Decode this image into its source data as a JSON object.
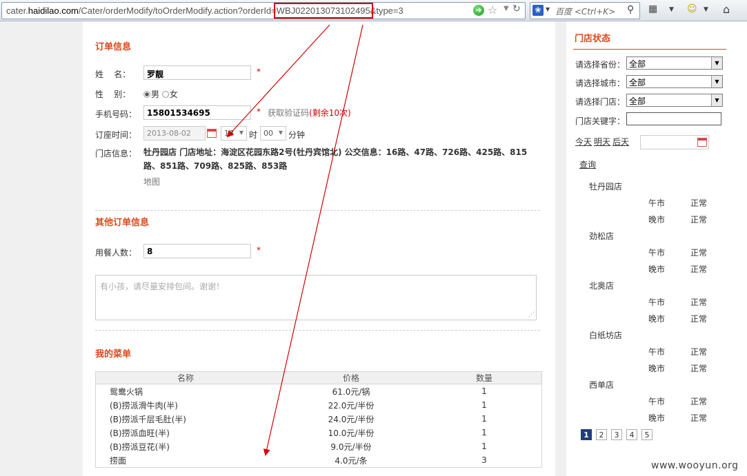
{
  "browser": {
    "url_prefix": "cater.",
    "url_host": "haidilao.com",
    "url_path": "/Cater/orderModify/toOrderModify.action?orderId=",
    "url_order_id": "WBJ022013073102495",
    "url_suffix": "&type=3",
    "search_placeholder": "百度 <Ctrl+K>"
  },
  "order_info": {
    "title": "订单信息",
    "name_label": "姓    名：",
    "name_value": "罗靓",
    "gender_label": "性    别：",
    "gender_male": "男",
    "gender_female": "女",
    "phone_label": "手机号码：",
    "phone_value": "15801534695",
    "get_code": "获取验证码",
    "remaining": "(剩余10次)",
    "time_label": "订座时间：",
    "date_value": "2013-08-02",
    "hour_value": "18",
    "hour_unit": "时",
    "minute_value": "00",
    "minute_unit": "分钟",
    "store_label": "门店信息：",
    "store_info": "牡丹园店 门店地址：海淀区花园东路2号(牡丹宾馆北) 公交信息：16路、47路、726路、425路、815路、851路、709路、825路、853路",
    "map_link": "地图",
    "required": "*"
  },
  "other_info": {
    "title": "其他订单信息",
    "diners_label": "用餐人数：",
    "diners_value": "8",
    "note_placeholder": "有小孩，请尽量安排包间。谢谢！"
  },
  "my_menu": {
    "title": "我的菜单",
    "headers": [
      "名称",
      "价格",
      "数量"
    ],
    "rows": [
      {
        "name": "鸳鸯火锅",
        "price": "61.0元/锅",
        "qty": "1"
      },
      {
        "name": "(B)捞派滑牛肉(半)",
        "price": "22.0元/半份",
        "qty": "1"
      },
      {
        "name": "(B)捞派千层毛肚(半)",
        "price": "24.0元/半份",
        "qty": "1"
      },
      {
        "name": "(B)捞派血旺(半)",
        "price": "10.0元/半份",
        "qty": "1"
      },
      {
        "name": "(B)捞派豆花(半)",
        "price": "9.0元/半份",
        "qty": "1"
      },
      {
        "name": "捞面",
        "price": "4.0元/条",
        "qty": "3"
      }
    ]
  },
  "side": {
    "title": "门店状态",
    "province_label": "请选择省份：",
    "city_label": "请选择城市：",
    "store_label": "请选择门店：",
    "keyword_label": "门店关键字：",
    "select_all": "全部",
    "today": "今天",
    "tomorrow": "明天",
    "after_tomorrow": "后天",
    "query": "查询",
    "lunch": "午市",
    "dinner": "晚市",
    "normal": "正常",
    "stores": [
      "牡丹园店",
      "劲松店",
      "北奥店",
      "白纸坊店",
      "西单店"
    ],
    "pages": [
      "1",
      "2",
      "3",
      "4",
      "5"
    ]
  },
  "watermark": "www.wooyun.org",
  "colors": {
    "accent": "#d9491b",
    "annotation": "#d40000",
    "page_active": "#1f3e7a"
  }
}
